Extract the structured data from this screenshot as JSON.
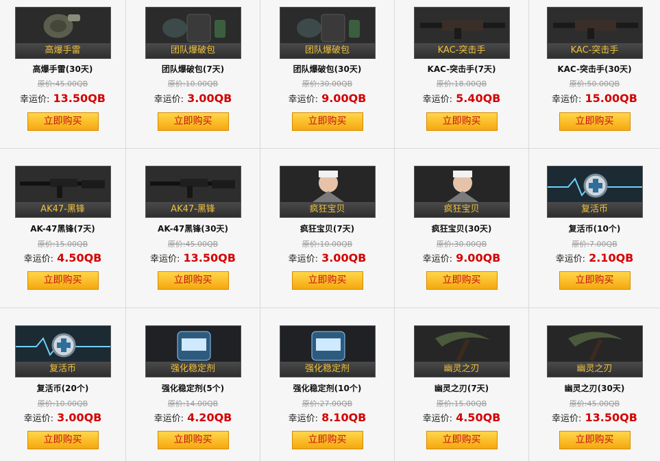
{
  "buy_label": "立即购买",
  "orig_prefix": "原价:",
  "lucky_label": "幸运价:",
  "colors": {
    "price": "#d40000",
    "tag": "#f2c23a",
    "button": "#f5b820"
  },
  "items": [
    {
      "tag": "高爆手雷",
      "name": "高爆手雷(30天)",
      "orig": "45.00QB",
      "price": "13.50QB",
      "art": "grenade"
    },
    {
      "tag": "团队爆破包",
      "name": "团队爆破包(7天)",
      "orig": "10.00QB",
      "price": "3.00QB",
      "art": "gear"
    },
    {
      "tag": "团队爆破包",
      "name": "团队爆破包(30天)",
      "orig": "30.00QB",
      "price": "9.00QB",
      "art": "gear"
    },
    {
      "tag": "KAC-突击手",
      "name": "KAC-突击手(7天)",
      "orig": "18.00QB",
      "price": "5.40QB",
      "art": "rifle"
    },
    {
      "tag": "KAC-突击手",
      "name": "KAC-突击手(30天)",
      "orig": "50.00QB",
      "price": "15.00QB",
      "art": "rifle"
    },
    {
      "tag": "AK47-黑锋",
      "name": "AK-47黑锋(7天)",
      "orig": "15.00QB",
      "price": "4.50QB",
      "art": "ak"
    },
    {
      "tag": "AK47-黑锋",
      "name": "AK-47黑锋(30天)",
      "orig": "45.00QB",
      "price": "13.50QB",
      "art": "ak"
    },
    {
      "tag": "疯狂宝贝",
      "name": "疯狂宝贝(7天)",
      "orig": "10.00QB",
      "price": "3.00QB",
      "art": "nurse"
    },
    {
      "tag": "疯狂宝贝",
      "name": "疯狂宝贝(30天)",
      "orig": "30.00QB",
      "price": "9.00QB",
      "art": "nurse"
    },
    {
      "tag": "复活币",
      "name": "复活币(10个)",
      "orig": "7.00QB",
      "price": "2.10QB",
      "art": "coin"
    },
    {
      "tag": "复活币",
      "name": "复活币(20个)",
      "orig": "10.00QB",
      "price": "3.00QB",
      "art": "coin"
    },
    {
      "tag": "强化稳定剂",
      "name": "强化稳定剂(5个)",
      "orig": "14.00QB",
      "price": "4.20QB",
      "art": "jar"
    },
    {
      "tag": "强化稳定剂",
      "name": "强化稳定剂(10个)",
      "orig": "27.00QB",
      "price": "8.10QB",
      "art": "jar"
    },
    {
      "tag": "幽灵之刃",
      "name": "幽灵之刃(7天)",
      "orig": "15.00QB",
      "price": "4.50QB",
      "art": "scythe"
    },
    {
      "tag": "幽灵之刃",
      "name": "幽灵之刃(30天)",
      "orig": "45.00QB",
      "price": "13.50QB",
      "art": "scythe"
    }
  ]
}
